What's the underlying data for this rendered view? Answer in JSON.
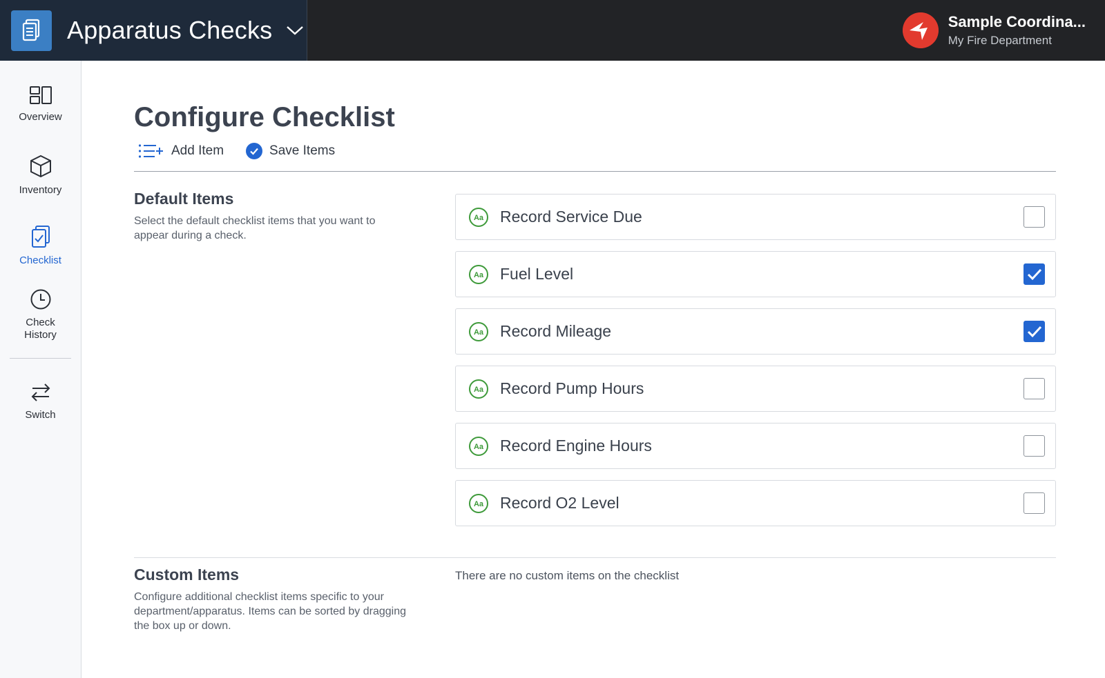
{
  "app": {
    "title": "Apparatus Checks",
    "logo_icon": "clipboard-list-icon",
    "brand_color": "#3b7fc4"
  },
  "user": {
    "name": "Sample Coordina...",
    "department": "My Fire Department"
  },
  "sidebar": {
    "items": [
      {
        "label": "Overview",
        "icon": "dashboard-icon",
        "active": false
      },
      {
        "label": "Inventory",
        "icon": "cube-icon",
        "active": false
      },
      {
        "label": "Checklist",
        "icon": "clipboard-check-icon",
        "active": true
      },
      {
        "label": "Check History",
        "icon": "clock-icon",
        "active": false
      },
      {
        "label": "Switch",
        "icon": "swap-arrows-icon",
        "active": false
      }
    ],
    "active_color": "#2366d1"
  },
  "page": {
    "title": "Configure Checklist",
    "toolbar": {
      "add_label": "Add Item",
      "save_label": "Save Items"
    }
  },
  "default_items": {
    "title": "Default Items",
    "description": "Select the default checklist items that you want to appear during a check.",
    "items": [
      {
        "label": "Record Service Due",
        "checked": false
      },
      {
        "label": "Fuel Level",
        "checked": true
      },
      {
        "label": "Record Mileage",
        "checked": true
      },
      {
        "label": "Record Pump Hours",
        "checked": false
      },
      {
        "label": "Record Engine Hours",
        "checked": false
      },
      {
        "label": "Record O2 Level",
        "checked": false
      }
    ],
    "item_icon": "text-field-icon",
    "item_icon_color": "#3e9a3a"
  },
  "custom_items": {
    "title": "Custom Items",
    "description": "Configure additional checklist items specific to your department/apparatus. Items can be sorted by dragging the box up or down.",
    "empty_message": "There are no custom items on the checklist"
  }
}
